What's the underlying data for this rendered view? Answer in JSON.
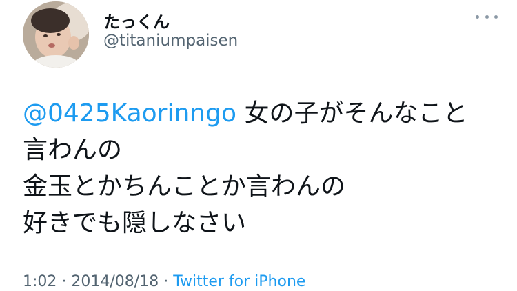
{
  "user": {
    "display_name": "たっくん",
    "handle": "@titaniumpaisen"
  },
  "tweet": {
    "mention": "@0425Kaorinngo",
    "first_line_rest": " 女の子がそんなこと",
    "lines": [
      "言わんの",
      "金玉とかちんことか言わんの",
      "好きでも隠しなさい"
    ]
  },
  "meta": {
    "time": "1:02",
    "separator1": " · ",
    "date": "2014/08/18",
    "separator2": " · ",
    "source": "Twitter for iPhone"
  },
  "icons": {
    "more": "more-icon",
    "avatar": "avatar-photo"
  },
  "colors": {
    "link": "#1d9bf0",
    "secondary_text": "#536471",
    "primary_text": "#0f1419"
  }
}
